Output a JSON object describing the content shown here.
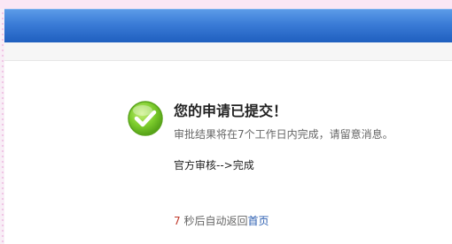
{
  "notice": {
    "title": "您的申请已提交！",
    "subtitle": "审批结果将在7个工作日内完成，请留意消息。",
    "progress": "官方审核-->完成"
  },
  "redirect": {
    "seconds": "7",
    "text": "秒后自动返回",
    "link_label": "首页"
  },
  "icons": {
    "success": "check-circle-icon"
  },
  "colors": {
    "header": "#3a7bd6",
    "success_green": "#6cc22c",
    "countdown": "#c0392b",
    "link": "#2a5db0"
  }
}
